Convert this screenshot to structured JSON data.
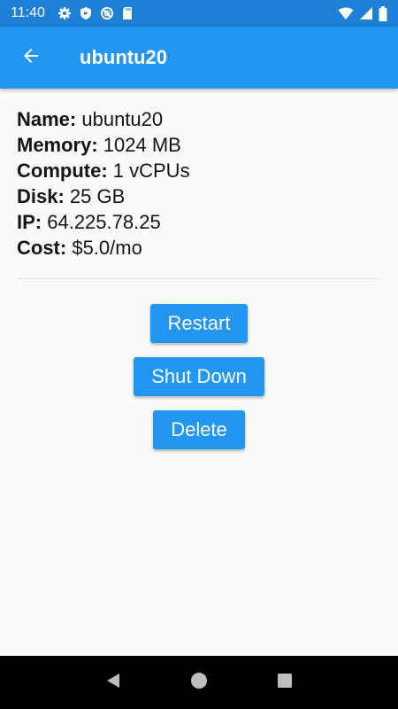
{
  "status_bar": {
    "time": "11:40",
    "left_icons": [
      "settings-gear-icon",
      "shield-icon",
      "no-disturb-icon",
      "sd-card-icon"
    ],
    "right_icons": [
      "wifi-icon",
      "cell-signal-icon",
      "battery-icon"
    ]
  },
  "app_bar": {
    "title": "ubuntu20",
    "back_icon": "arrow-back-icon",
    "color": "#2196f3"
  },
  "details": [
    {
      "key": "Name:",
      "value": " ubuntu20"
    },
    {
      "key": "Memory:",
      "value": " 1024 MB"
    },
    {
      "key": "Compute:",
      "value": " 1 vCPUs"
    },
    {
      "key": "Disk:",
      "value": " 25 GB"
    },
    {
      "key": "IP:",
      "value": " 64.225.78.25"
    },
    {
      "key": "Cost:",
      "value": " $5.0/mo"
    }
  ],
  "actions": {
    "restart_label": "Restart",
    "shutdown_label": "Shut Down",
    "delete_label": "Delete"
  },
  "nav_bar": {
    "icons": [
      "back-triangle-icon",
      "home-circle-icon",
      "recents-square-icon"
    ]
  }
}
